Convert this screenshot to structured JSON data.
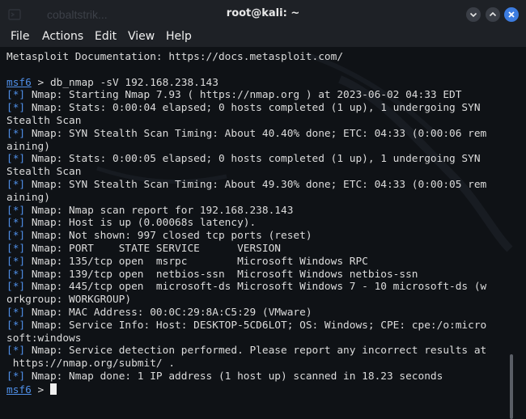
{
  "window": {
    "title": "root@kali: ~",
    "ghost_tab": "cobaltstrik..."
  },
  "menu": [
    "File",
    "Actions",
    "Edit",
    "View",
    "Help"
  ],
  "terminal": {
    "lines": [
      {
        "type": "text",
        "text": "Metasploit Documentation: https://docs.metasploit.com/"
      },
      {
        "type": "text",
        "text": ""
      },
      {
        "type": "prompt",
        "prompt": "msf6",
        "text": " > db_nmap -sV 192.168.238.143"
      },
      {
        "type": "tag",
        "tag": "[*]",
        "text": " Nmap: Starting Nmap 7.93 ( https://nmap.org ) at 2023-06-02 04:33 EDT"
      },
      {
        "type": "tag",
        "tag": "[*]",
        "text": " Nmap: Stats: 0:00:04 elapsed; 0 hosts completed (1 up), 1 undergoing SYN"
      },
      {
        "type": "text",
        "text": "Stealth Scan"
      },
      {
        "type": "tag",
        "tag": "[*]",
        "text": " Nmap: SYN Stealth Scan Timing: About 40.40% done; ETC: 04:33 (0:00:06 rem"
      },
      {
        "type": "text",
        "text": "aining)"
      },
      {
        "type": "tag",
        "tag": "[*]",
        "text": " Nmap: Stats: 0:00:05 elapsed; 0 hosts completed (1 up), 1 undergoing SYN"
      },
      {
        "type": "text",
        "text": "Stealth Scan"
      },
      {
        "type": "tag",
        "tag": "[*]",
        "text": " Nmap: SYN Stealth Scan Timing: About 49.30% done; ETC: 04:33 (0:00:05 rem"
      },
      {
        "type": "text",
        "text": "aining)"
      },
      {
        "type": "tag",
        "tag": "[*]",
        "text": " Nmap: Nmap scan report for 192.168.238.143"
      },
      {
        "type": "tag",
        "tag": "[*]",
        "text": " Nmap: Host is up (0.00068s latency)."
      },
      {
        "type": "tag",
        "tag": "[*]",
        "text": " Nmap: Not shown: 997 closed tcp ports (reset)"
      },
      {
        "type": "tag",
        "tag": "[*]",
        "text": " Nmap: PORT    STATE SERVICE      VERSION"
      },
      {
        "type": "tag",
        "tag": "[*]",
        "text": " Nmap: 135/tcp open  msrpc        Microsoft Windows RPC"
      },
      {
        "type": "tag",
        "tag": "[*]",
        "text": " Nmap: 139/tcp open  netbios-ssn  Microsoft Windows netbios-ssn"
      },
      {
        "type": "tag",
        "tag": "[*]",
        "text": " Nmap: 445/tcp open  microsoft-ds Microsoft Windows 7 - 10 microsoft-ds (w"
      },
      {
        "type": "text",
        "text": "orkgroup: WORKGROUP)"
      },
      {
        "type": "tag",
        "tag": "[*]",
        "text": " Nmap: MAC Address: 00:0C:29:8A:C5:29 (VMware)"
      },
      {
        "type": "tag",
        "tag": "[*]",
        "text": " Nmap: Service Info: Host: DESKTOP-5CD6LOT; OS: Windows; CPE: cpe:/o:micro"
      },
      {
        "type": "text",
        "text": "soft:windows"
      },
      {
        "type": "tag",
        "tag": "[*]",
        "text": " Nmap: Service detection performed. Please report any incorrect results at"
      },
      {
        "type": "text",
        "text": " https://nmap.org/submit/ ."
      },
      {
        "type": "tag",
        "tag": "[*]",
        "text": " Nmap: Nmap done: 1 IP address (1 host up) scanned in 18.23 seconds"
      },
      {
        "type": "cursor",
        "prompt": "msf6",
        "text": " > "
      }
    ]
  },
  "colors": {
    "accent": "#4f8fe8",
    "close_button": "#3c7ce0",
    "background": "#0f1216",
    "text": "#dcdcdc"
  }
}
